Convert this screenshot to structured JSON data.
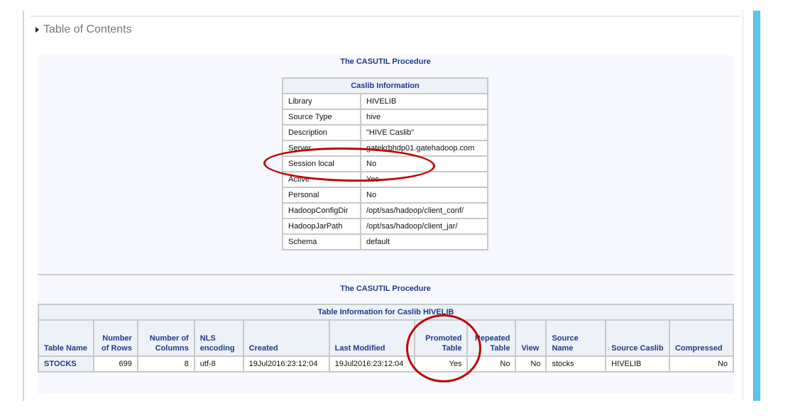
{
  "toc_label": "Table of Contents",
  "proc_title_1": "The CASUTIL Procedure",
  "caslib": {
    "caption": "Caslib Information",
    "rows": [
      [
        "Library",
        "HIVELIB"
      ],
      [
        "Source Type",
        "hive"
      ],
      [
        "Description",
        "\"HIVE Caslib\""
      ],
      [
        "Server",
        "gatekrbhdp01.gatehadoop.com"
      ],
      [
        "Session local",
        "No"
      ],
      [
        "Active",
        "Yes"
      ],
      [
        "Personal",
        "No"
      ],
      [
        "HadoopConfigDir",
        "/opt/sas/hadoop/client_conf/"
      ],
      [
        "HadoopJarPath",
        "/opt/sas/hadoop/client_jar/"
      ],
      [
        "Schema",
        "default"
      ]
    ]
  },
  "proc_title_2": "The CASUTIL Procedure",
  "tableinfo": {
    "caption": "Table Information for Caslib HIVELIB",
    "headers": [
      "Table Name",
      "Number of Rows",
      "Number of Columns",
      "NLS encoding",
      "Created",
      "Last Modified",
      "Promoted Table",
      "Repeated Table",
      "View",
      "Source Name",
      "Source Caslib",
      "Compressed"
    ],
    "row": [
      "STOCKS",
      "699",
      "8",
      "utf-8",
      "19Jul2016:23:12:04",
      "19Jul2016:23:12:04",
      "Yes",
      "No",
      "No",
      "stocks",
      "HIVELIB",
      "No"
    ]
  },
  "annotation_color": "#c00000"
}
